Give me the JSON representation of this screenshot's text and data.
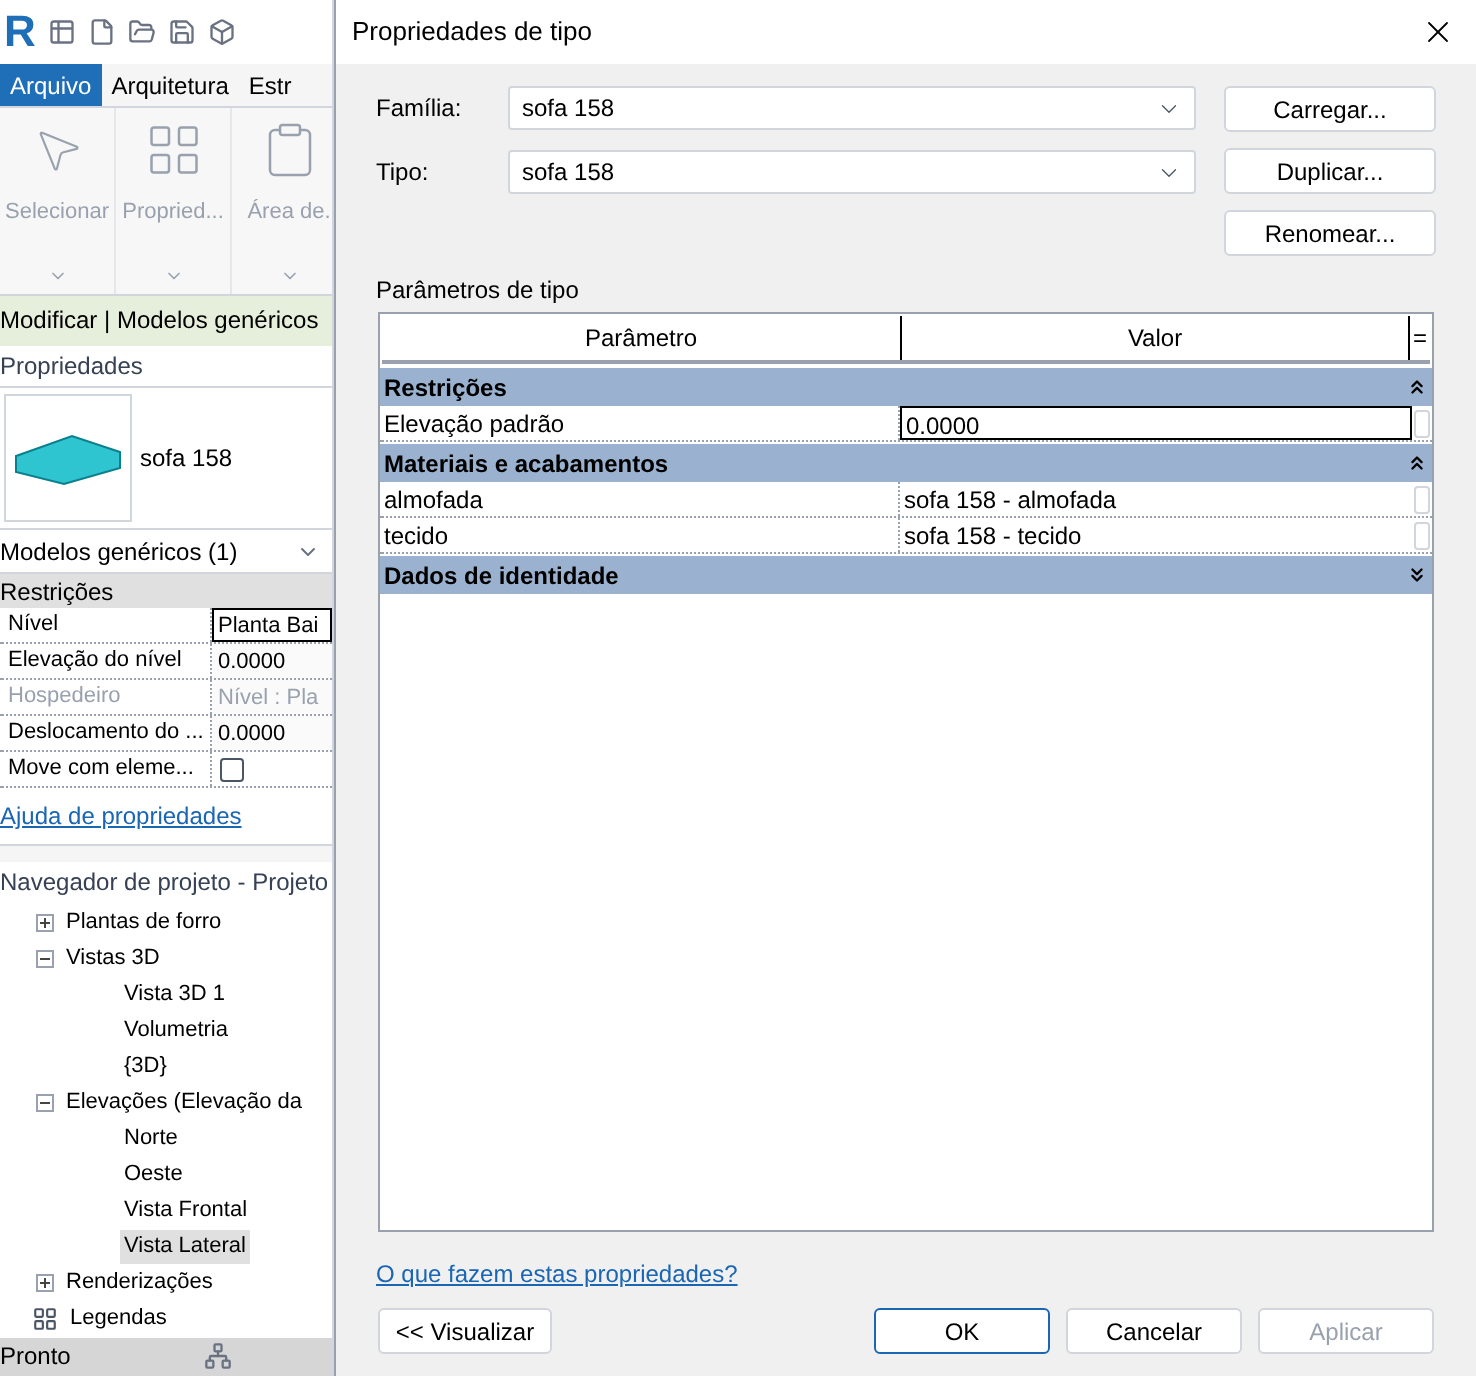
{
  "app": {
    "logo": "R",
    "tabs": [
      {
        "label": "Arquivo",
        "selected": true
      },
      {
        "label": "Arquitetura",
        "selected": false
      },
      {
        "label": "Estr",
        "selected": false
      }
    ],
    "ribbon": [
      {
        "label": "Selecionar",
        "kind": "select",
        "disabled": true
      },
      {
        "label": "Propried...",
        "kind": "properties",
        "disabled": true
      },
      {
        "label": "Área de.",
        "kind": "clipboard",
        "disabled": true
      }
    ],
    "context_bar": "Modificar | Modelos genéricos",
    "properties": {
      "title": "Propriedades",
      "type_name": "sofa 158",
      "filter": "Modelos genéricos (1)",
      "group": "Restrições",
      "rows": [
        {
          "label": "Nível",
          "value": "Planta Bai",
          "kind": "text",
          "active": true,
          "disabled": false
        },
        {
          "label": "Elevação do nível",
          "value": "0.0000",
          "kind": "text",
          "active": false,
          "disabled": false
        },
        {
          "label": "Hospedeiro",
          "value": "Nível : Pla",
          "kind": "text",
          "active": false,
          "disabled": true
        },
        {
          "label": "Deslocamento do ...",
          "value": "0.0000",
          "kind": "text",
          "active": false,
          "disabled": false
        },
        {
          "label": "Move com eleme...",
          "kind": "checkbox",
          "checked": false,
          "disabled": false
        }
      ],
      "help_link": "Ajuda de propriedades"
    },
    "browser": {
      "title": "Navegador de projeto - Projeto",
      "items": [
        {
          "label": "Plantas de forro",
          "kind": "group",
          "expanded": false
        },
        {
          "label": "Vistas 3D",
          "kind": "group",
          "expanded": true,
          "children": [
            {
              "label": "Vista 3D 1",
              "selected": false
            },
            {
              "label": "Volumetria",
              "selected": false
            },
            {
              "label": "{3D}",
              "selected": false
            }
          ]
        },
        {
          "label": "Elevações (Elevação da",
          "kind": "group",
          "expanded": true,
          "children": [
            {
              "label": "Norte",
              "selected": false
            },
            {
              "label": "Oeste",
              "selected": false
            },
            {
              "label": "Vista Frontal",
              "selected": false
            },
            {
              "label": "Vista Lateral",
              "selected": true
            }
          ]
        },
        {
          "label": "Renderizações",
          "kind": "group",
          "expanded": false
        },
        {
          "label": "Legendas",
          "kind": "legend"
        }
      ]
    },
    "status_bar": "Pronto"
  },
  "dialog": {
    "title": "Propriedades de tipo",
    "fields": [
      {
        "label": "Família:",
        "value": "sofa 158"
      },
      {
        "label": "Tipo:",
        "value": "sofa 158"
      }
    ],
    "side_buttons": [
      {
        "label": "Carregar..."
      },
      {
        "label": "Duplicar..."
      },
      {
        "label": "Renomear..."
      }
    ],
    "section_label": "Parâmetros de tipo",
    "table": {
      "columns": [
        "Parâmetro",
        "Valor"
      ],
      "corner": "=",
      "groups": [
        {
          "label": "Restrições",
          "expanded": true,
          "rows": [
            {
              "name": "Elevação padrão",
              "value": "0.0000",
              "active": true
            }
          ]
        },
        {
          "label": "Materiais e acabamentos",
          "expanded": true,
          "rows": [
            {
              "name": "almofada",
              "value": "sofa 158 - almofada",
              "active": false
            },
            {
              "name": "tecido",
              "value": "sofa 158 - tecido",
              "active": false
            }
          ]
        },
        {
          "label": "Dados de identidade",
          "expanded": false
        }
      ]
    },
    "help_link": "O que fazem estas propriedades?",
    "preview_button": "<< Visualizar",
    "buttons": [
      {
        "label": "OK",
        "kind": "default",
        "disabled": false
      },
      {
        "label": "Cancelar",
        "kind": "normal",
        "disabled": false
      },
      {
        "label": "Aplicar",
        "kind": "normal",
        "disabled": true
      }
    ]
  }
}
